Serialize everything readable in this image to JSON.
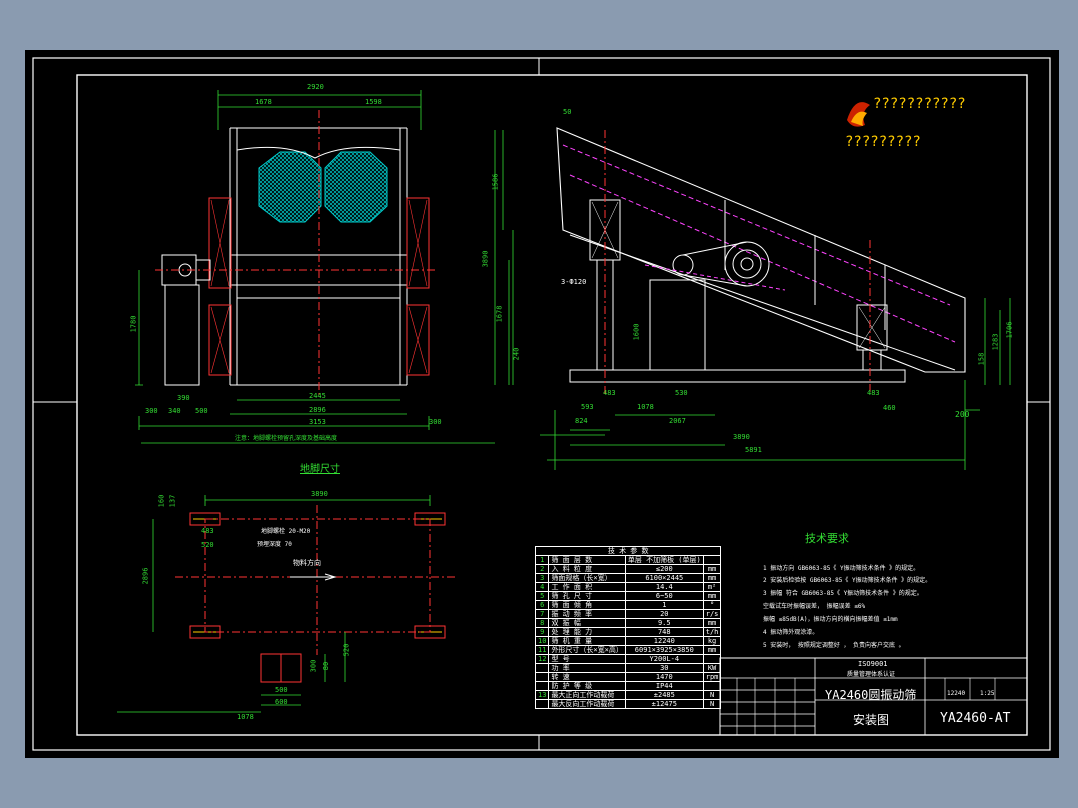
{
  "logo": {
    "line1": "???????????",
    "line2": "?????????"
  },
  "dims_front": {
    "overall_width": "2920",
    "left_half": "1678",
    "right_half": "1598",
    "height": "1780",
    "inner": "2445",
    "d2896": "2896",
    "d3153": "3153",
    "b300a": "300",
    "b340": "340",
    "b500": "500",
    "b300b": "300",
    "b390": "390",
    "note": "注意：地脚螺栓预留孔深度及基础高度"
  },
  "dims_side": {
    "d50": "50",
    "d1586": "1586",
    "d3890": "3890",
    "d1678": "1678",
    "d1600": "1600",
    "d240": "240",
    "hole": "3-Ф120",
    "d593": "593",
    "d1078": "1078",
    "d483a": "483",
    "d530": "530",
    "d824": "824",
    "d2067": "2067",
    "d3890b": "3890",
    "d5891": "5891",
    "d483b": "483",
    "d460": "460",
    "d200": "200",
    "d158": "158",
    "d1283": "1283",
    "d1706": "1706"
  },
  "foundation": {
    "title": "地脚尺寸",
    "d3890": "3890",
    "d160": "160",
    "d137": "137",
    "d483": "483",
    "d520": "520",
    "d2896": "2896",
    "bolt": "地脚螺栓 20-M20",
    "depth": "预埋深度 70",
    "flow": "物料方向",
    "d500": "500",
    "d600": "600",
    "d300": "300",
    "d80": "80",
    "d520b": "520",
    "d1078": "1078"
  },
  "tech": {
    "title": "技术要求",
    "lines": [
      "1 振动方向 GB6063-85《 Y振动筛技术条件 》的规定。",
      "2 安装后检验按 GB6063-85《 Y振动筛技术条件 》的规定。",
      "3 振幅 符合 GB6063-85《 Y振动筛技术条件 》的规定。",
      "  空载试车时振幅误差， 振幅误差 ≤6%",
      "  振幅 ≤85dB(A)，振动方向的横向振幅差值 ≤1mm",
      "4 振动筛外观涂漆。",
      "5 安装时， 按照规定调整好 ， 负责向客户交底 。"
    ]
  },
  "spec_table": {
    "header": "技 术 参 数",
    "rows": [
      {
        "no": "1",
        "name": "筛 面 层 数",
        "value": "单层 不加筛板 (单层)",
        "unit": ""
      },
      {
        "no": "2",
        "name": "入 料 粒 度",
        "value": "≤200",
        "unit": "mm"
      },
      {
        "no": "3",
        "name": "筛面规格（长×宽）",
        "value": "6100×2445",
        "unit": "mm"
      },
      {
        "no": "4",
        "name": "工 作 面 积",
        "value": "14.4",
        "unit": "m²"
      },
      {
        "no": "5",
        "name": "筛 孔 尺 寸",
        "value": "6~50",
        "unit": "mm"
      },
      {
        "no": "6",
        "name": "筛 面 倾 角",
        "value": "1",
        "unit": "°"
      },
      {
        "no": "7",
        "name": "振 动 频 率",
        "value": "20",
        "unit": "r/s"
      },
      {
        "no": "8",
        "name": "双 振 幅",
        "value": "9.5",
        "unit": "mm"
      },
      {
        "no": "9",
        "name": "处 理 能 力",
        "value": "748",
        "unit": "t/h"
      },
      {
        "no": "10",
        "name": "筛 机 重 量",
        "value": "12240",
        "unit": "kg"
      },
      {
        "no": "11",
        "name": "外形尺寸（长×宽×高）",
        "value": "6091×3925×3850",
        "unit": "mm"
      },
      {
        "no": "12",
        "name": "型 号",
        "value": "Y200L-4",
        "unit": ""
      },
      {
        "no": "",
        "name": "功 率",
        "value": "30",
        "unit": "KW"
      },
      {
        "no": "",
        "name": "转 速",
        "value": "1470",
        "unit": "rpm"
      },
      {
        "no": "",
        "name": "防 护 等 级",
        "value": "IP44",
        "unit": ""
      },
      {
        "no": "13",
        "name": "最大正向工作动载荷",
        "value": "±2485",
        "unit": "N"
      },
      {
        "no": "",
        "name": "最大反向工作动载荷",
        "value": "±12475",
        "unit": "N"
      }
    ]
  },
  "title_block": {
    "iso": "ISO9001",
    "iso_sub": "质量管理体系认证",
    "name": "YA2460圆振动筛",
    "sub": "安装图",
    "code": "YA2460-AT",
    "scale": "1:25",
    "weight": "12240"
  },
  "colors": {
    "frame": "#ffffff",
    "dim": "#33dd33",
    "center": "#ff3333",
    "mesh": "#00cccc",
    "path": "#ff44ff"
  }
}
